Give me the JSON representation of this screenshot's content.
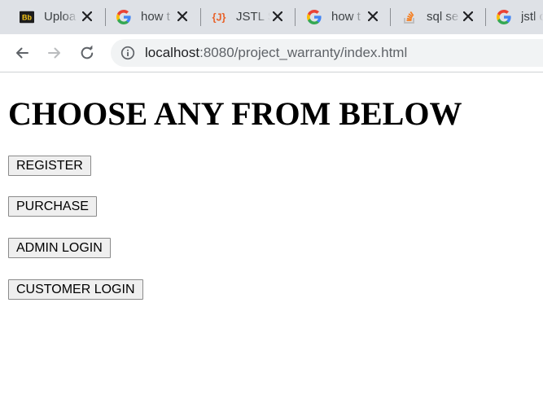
{
  "tabs": [
    {
      "title": "Uploa",
      "favicon": "blackboard-icon"
    },
    {
      "title": "how t",
      "favicon": "google-icon"
    },
    {
      "title": "JSTL S",
      "favicon": "jstl-icon"
    },
    {
      "title": "how t",
      "favicon": "google-icon"
    },
    {
      "title": "sql se",
      "favicon": "stackoverflow-icon"
    },
    {
      "title": "jstl c",
      "favicon": "google-icon"
    }
  ],
  "address_bar": {
    "host": "localhost",
    "rest": ":8080/project_warranty/index.html"
  },
  "page": {
    "heading": "CHOOSE ANY FROM BELOW",
    "buttons": [
      {
        "label": "REGISTER"
      },
      {
        "label": "PURCHASE"
      },
      {
        "label": "ADMIN LOGIN"
      },
      {
        "label": "CUSTOMER LOGIN"
      }
    ]
  },
  "colors": {
    "tabstrip_bg": "#dee1e6",
    "omnibox_bg": "#f1f3f4",
    "button_bg": "#efefef",
    "jstl_accent": "#e8622a",
    "stackoverflow_accent": "#f48024"
  }
}
